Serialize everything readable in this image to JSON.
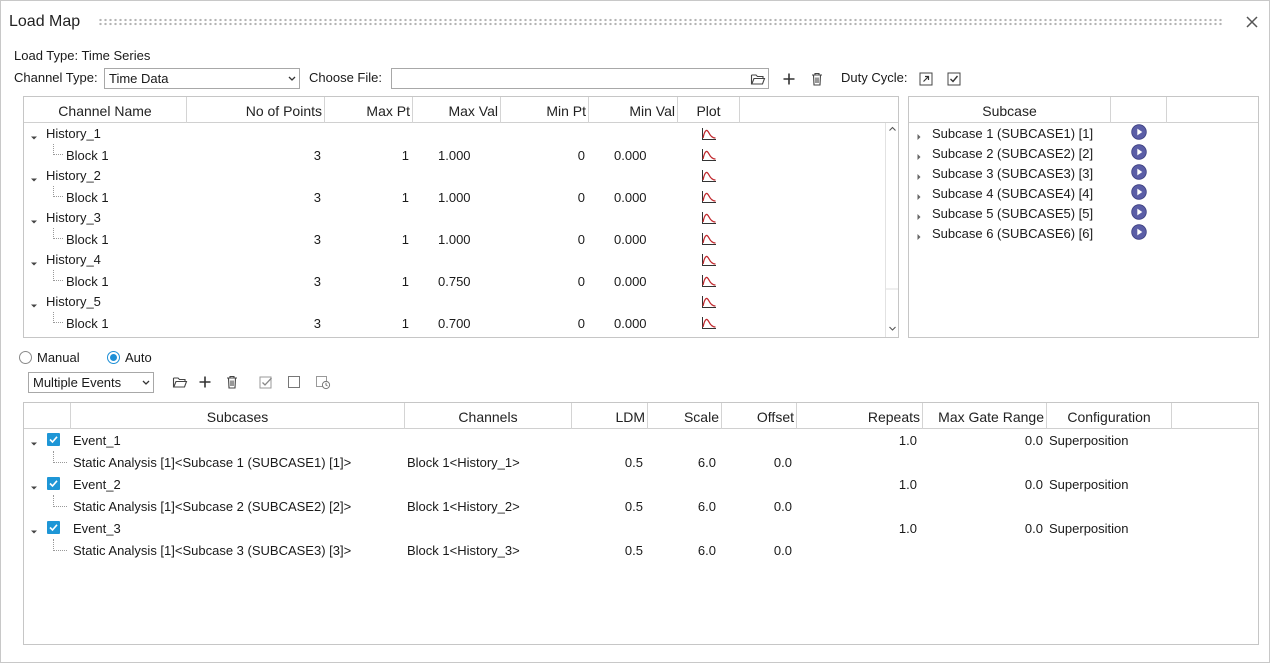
{
  "window": {
    "title": "Load Map"
  },
  "top": {
    "load_type_label": "Load Type: Time Series",
    "channel_type_label": "Channel Type:",
    "channel_type_value": "Time Data",
    "choose_file_label": "Choose File:",
    "choose_file_value": "",
    "duty_cycle_label": "Duty Cycle:"
  },
  "channels": {
    "columns": [
      "Channel Name",
      "No of Points",
      "Max Pt",
      "Max Val",
      "Min Pt",
      "Min Val",
      "Plot"
    ],
    "rows": [
      {
        "kind": "history",
        "name": "History_1"
      },
      {
        "kind": "block",
        "name": "Block 1",
        "points": "3",
        "max_pt": "1",
        "max_val": "1.000",
        "min_pt": "0",
        "min_val": "0.000"
      },
      {
        "kind": "history",
        "name": "History_2"
      },
      {
        "kind": "block",
        "name": "Block 1",
        "points": "3",
        "max_pt": "1",
        "max_val": "1.000",
        "min_pt": "0",
        "min_val": "0.000"
      },
      {
        "kind": "history",
        "name": "History_3"
      },
      {
        "kind": "block",
        "name": "Block 1",
        "points": "3",
        "max_pt": "1",
        "max_val": "1.000",
        "min_pt": "0",
        "min_val": "0.000"
      },
      {
        "kind": "history",
        "name": "History_4"
      },
      {
        "kind": "block",
        "name": "Block 1",
        "points": "3",
        "max_pt": "1",
        "max_val": "0.750",
        "min_pt": "0",
        "min_val": "0.000"
      },
      {
        "kind": "history",
        "name": "History_5"
      },
      {
        "kind": "block",
        "name": "Block 1",
        "points": "3",
        "max_pt": "1",
        "max_val": "0.700",
        "min_pt": "0",
        "min_val": "0.000"
      }
    ]
  },
  "subcase_panel": {
    "header": "Subcase",
    "items": [
      "Subcase 1 (SUBCASE1) [1]",
      "Subcase 2 (SUBCASE2) [2]",
      "Subcase 3 (SUBCASE3) [3]",
      "Subcase 4 (SUBCASE4) [4]",
      "Subcase 5 (SUBCASE5) [5]",
      "Subcase 6 (SUBCASE6) [6]"
    ]
  },
  "mode": {
    "manual_label": "Manual",
    "auto_label": "Auto",
    "selected": "Auto"
  },
  "events_toolbar": {
    "events_type_value": "Multiple Events"
  },
  "events": {
    "columns": [
      "Subcases",
      "Channels",
      "LDM",
      "Scale",
      "Offset",
      "Repeats",
      "Max Gate Range",
      "Configuration"
    ],
    "rows": [
      {
        "name": "Event_1",
        "repeats": "1.0",
        "max_gate": "0.0",
        "config": "Superposition",
        "child": {
          "subcase": "Static Analysis [1]<Subcase 1 (SUBCASE1) [1]>",
          "channel": "Block 1<History_1>",
          "ldm": "0.5",
          "scale": "6.0",
          "offset": "0.0"
        }
      },
      {
        "name": "Event_2",
        "repeats": "1.0",
        "max_gate": "0.0",
        "config": "Superposition",
        "child": {
          "subcase": "Static Analysis [1]<Subcase 2 (SUBCASE2) [2]>",
          "channel": "Block 1<History_2>",
          "ldm": "0.5",
          "scale": "6.0",
          "offset": "0.0"
        }
      },
      {
        "name": "Event_3",
        "repeats": "1.0",
        "max_gate": "0.0",
        "config": "Superposition",
        "child": {
          "subcase": "Static Analysis [1]<Subcase 3 (SUBCASE3) [3]>",
          "channel": "Block 1<History_3>",
          "ldm": "0.5",
          "scale": "6.0",
          "offset": "0.0"
        }
      }
    ]
  },
  "colors": {
    "accent": "#1e96d6",
    "plot_icon": "#c0282d",
    "play_icon": "#5b5ea6"
  },
  "icons": {
    "close": "close-icon",
    "folder": "folder-open-icon",
    "add": "plus-icon",
    "delete": "trash-icon",
    "duty_cycle_export": "export-icon",
    "duty_cycle_check": "checkbox-icon",
    "plot": "plot-curve-icon",
    "play": "play-icon",
    "select_all": "check-all-icon",
    "deselect": "uncheck-icon",
    "refresh": "refresh-icon"
  }
}
